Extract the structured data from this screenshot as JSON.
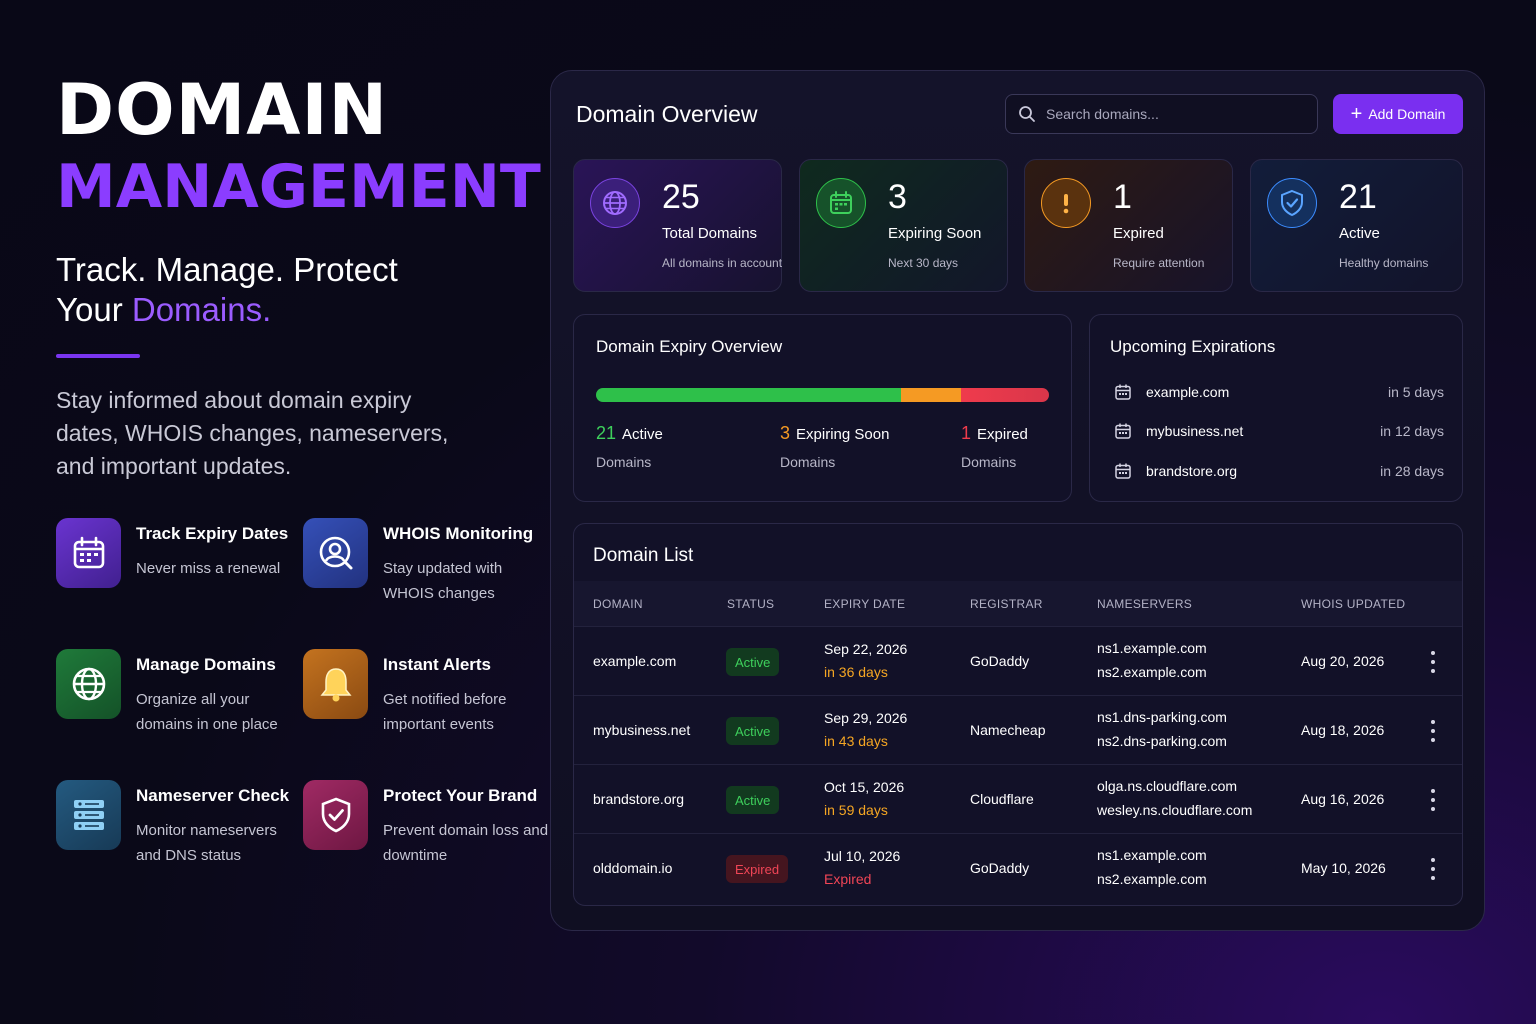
{
  "hero": {
    "title_line1": "DOMAIN",
    "title_line2": "MANAGEMENT",
    "tagline_part1": "Track. Manage. Protect",
    "tagline_part2": "Your ",
    "tagline_accent": "Domains.",
    "description": "Stay informed about domain expiry dates, WHOIS changes, nameservers, and important updates."
  },
  "features": [
    {
      "icon": "calendar-icon",
      "title": "Track Expiry Dates",
      "desc": "Never miss a renewal",
      "color": "#5b2bb8"
    },
    {
      "icon": "user-search-icon",
      "title": "WHOIS Monitoring",
      "desc": "Stay updated with WHOIS changes",
      "color": "#2a3f9e"
    },
    {
      "icon": "globe-icon",
      "title": "Manage Domains",
      "desc": "Organize all your domains in one place",
      "color": "#1d6b33"
    },
    {
      "icon": "bell-icon",
      "title": "Instant Alerts",
      "desc": "Get notified before important events",
      "color": "#b8651a"
    },
    {
      "icon": "server-icon",
      "title": "Nameserver Check",
      "desc": "Monitor nameservers and DNS status",
      "color": "#1e4d6e"
    },
    {
      "icon": "shield-check-icon",
      "title": "Protect Your Brand",
      "desc": "Prevent domain loss and downtime",
      "color": "#8e1f55"
    }
  ],
  "dashboard": {
    "title": "Domain Overview",
    "search_placeholder": "Search domains...",
    "add_button": "Add Domain",
    "stats": [
      {
        "icon": "globe-icon",
        "value": "25",
        "label": "Total Domains",
        "sub": "All domains in account",
        "color": "#8b3dff"
      },
      {
        "icon": "calendar-icon",
        "value": "3",
        "label": "Expiring Soon",
        "sub": "Next 30 days",
        "color": "#2ec04a"
      },
      {
        "icon": "exclamation-icon",
        "value": "1",
        "label": "Expired",
        "sub": "Require attention",
        "color": "#f59a23"
      },
      {
        "icon": "shield-check-icon",
        "value": "21",
        "label": "Active",
        "sub": "Healthy domains",
        "color": "#3b8cff"
      }
    ],
    "expiry_overview": {
      "title": "Domain Expiry Overview",
      "active_count": "21",
      "active_label": "Active",
      "expiring_count": "3",
      "expiring_label": "Expiring Soon",
      "expired_count": "1",
      "expired_label": "Expired",
      "sub_label": "Domains",
      "colors": {
        "active": "#2ec04a",
        "expiring": "#f59a23",
        "expired": "#ef3b4c"
      }
    },
    "upcoming": {
      "title": "Upcoming Expirations",
      "items": [
        {
          "domain": "example.com",
          "days": "in 5 days"
        },
        {
          "domain": "mybusiness.net",
          "days": "in 12 days"
        },
        {
          "domain": "brandstore.org",
          "days": "in 28 days"
        }
      ]
    },
    "domain_list": {
      "title": "Domain List",
      "headers": [
        "DOMAIN",
        "STATUS",
        "EXPIRY DATE",
        "REGISTRAR",
        "NAMESERVERS",
        "WHOIS UPDATED"
      ],
      "rows": [
        {
          "domain": "example.com",
          "status": "Active",
          "expiry": "Sep 22, 2026",
          "relative": "in 36 days",
          "registrar": "GoDaddy",
          "ns1": "ns1.example.com",
          "ns2": "ns2.example.com",
          "whois": "Aug 20, 2026"
        },
        {
          "domain": "mybusiness.net",
          "status": "Active",
          "expiry": "Sep 29, 2026",
          "relative": "in 43 days",
          "registrar": "Namecheap",
          "ns1": "ns1.dns-parking.com",
          "ns2": "ns2.dns-parking.com",
          "whois": "Aug 18, 2026"
        },
        {
          "domain": "brandstore.org",
          "status": "Active",
          "expiry": "Oct 15, 2026",
          "relative": "in 59 days",
          "registrar": "Cloudflare",
          "ns1": "olga.ns.cloudflare.com",
          "ns2": "wesley.ns.cloudflare.com",
          "whois": "Aug 16, 2026"
        },
        {
          "domain": "olddomain.io",
          "status": "Expired",
          "expiry": "Jul 10, 2026",
          "relative": "Expired",
          "registrar": "GoDaddy",
          "ns1": "ns1.example.com",
          "ns2": "ns2.example.com",
          "whois": "May 10, 2026"
        }
      ]
    }
  }
}
